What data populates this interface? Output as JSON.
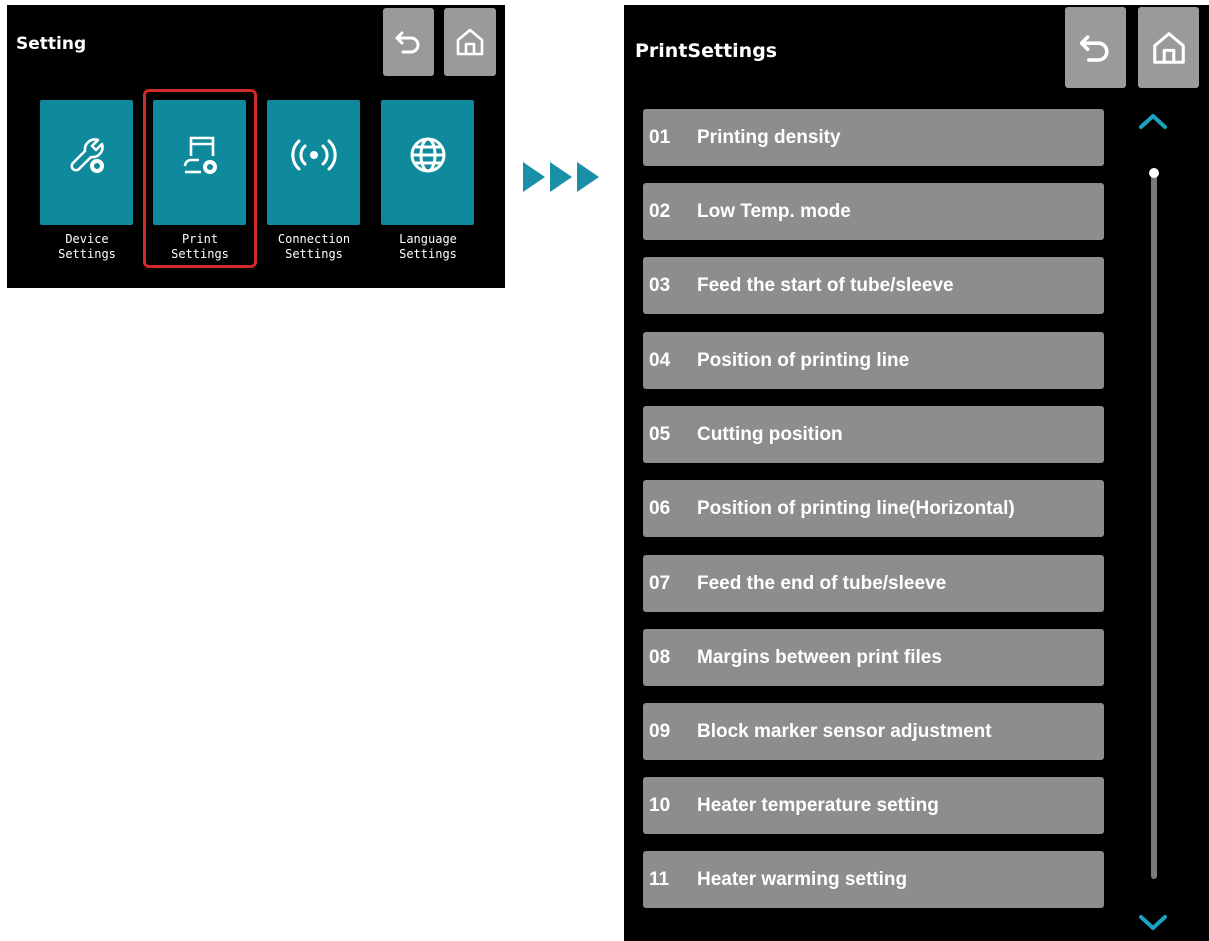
{
  "left_screen": {
    "title": "Setting",
    "tiles": [
      {
        "label": "Device\nSettings",
        "icon": "wrench-gear-icon"
      },
      {
        "label": "Print\nSettings",
        "icon": "printer-gear-icon"
      },
      {
        "label": "Connection\nSettings",
        "icon": "wireless-signal-icon"
      },
      {
        "label": "Language\nSettings",
        "icon": "globe-icon"
      }
    ],
    "highlighted": "Print Settings"
  },
  "right_screen": {
    "title": "PrintSettings",
    "items": [
      {
        "num": "01",
        "label": "Printing density"
      },
      {
        "num": "02",
        "label": "Low Temp. mode"
      },
      {
        "num": "03",
        "label": "Feed the start of tube/sleeve"
      },
      {
        "num": "04",
        "label": "Position of printing line"
      },
      {
        "num": "05",
        "label": "Cutting position"
      },
      {
        "num": "06",
        "label": "Position of printing line(Horizontal)"
      },
      {
        "num": "07",
        "label": "Feed the end of tube/sleeve"
      },
      {
        "num": "08",
        "label": "Margins between print files"
      },
      {
        "num": "09",
        "label": "Block marker sensor adjustment"
      },
      {
        "num": "10",
        "label": "Heater temperature setting"
      },
      {
        "num": "11",
        "label": "Heater warming setting"
      }
    ],
    "scroll_position": 0
  },
  "colors": {
    "accent": "#0e8a9c",
    "highlight": "#d02a2a",
    "button": "#9a9a9a",
    "list_item": "#8d8d8d"
  }
}
